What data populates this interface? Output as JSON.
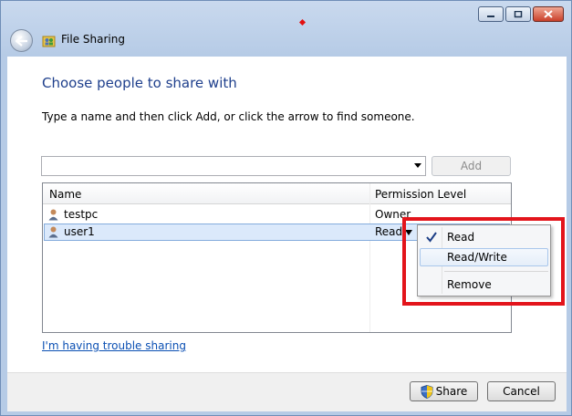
{
  "window": {
    "title": "File Sharing",
    "close_color": "#c9402a"
  },
  "main": {
    "heading": "Choose people to share with",
    "instruction": "Type a name and then click Add, or click the arrow to find someone.",
    "name_input": {
      "value": "",
      "placeholder": ""
    },
    "add_label": "Add"
  },
  "list": {
    "columns": [
      "Name",
      "Permission Level"
    ],
    "rows": [
      {
        "name": "testpc",
        "permission": "Owner"
      },
      {
        "name": "user1",
        "permission": "Read"
      }
    ]
  },
  "menu": {
    "items": [
      {
        "label": "Read",
        "checked": true
      },
      {
        "label": "Read/Write",
        "checked": false
      },
      {
        "label": "Remove",
        "checked": false
      }
    ]
  },
  "links": {
    "trouble": "I'm having trouble sharing"
  },
  "footer": {
    "share_label": "Share",
    "cancel_label": "Cancel"
  },
  "colors": {
    "heading": "#1e3f8c",
    "link": "#0a4fb3",
    "highlight": "#e3141b"
  },
  "icons": [
    "back-arrow-icon",
    "file-sharing-icon",
    "user-icon",
    "check-icon",
    "shield-icon",
    "minimize-icon",
    "maximize-icon",
    "close-icon"
  ]
}
